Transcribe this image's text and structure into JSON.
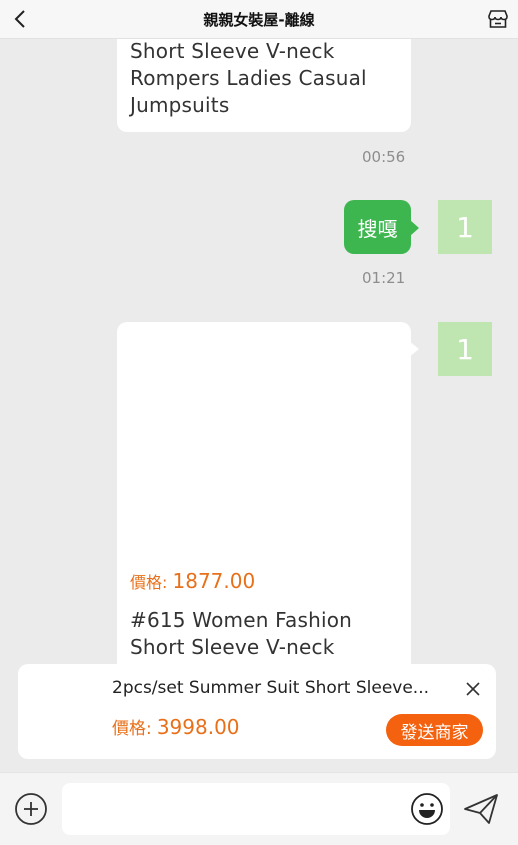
{
  "header": {
    "title": "親親女裝屋-離線",
    "back_icon": "back-arrow-icon",
    "shop_icon": "shop-icon"
  },
  "messages": {
    "first_product": {
      "text_lines": [
        "Short Sleeve V-neck",
        "Rompers Ladies Casual",
        "Jumpsuits"
      ],
      "time": "00:56"
    },
    "reply": {
      "text": "搜嘎",
      "time": "01:21"
    },
    "avatar_text": "1",
    "second_product": {
      "price_label": "價格:",
      "price": "1877.00",
      "text_lines": [
        "#615 Women Fashion",
        "Short Sleeve V-neck"
      ]
    }
  },
  "product_card": {
    "name": "2pcs/set Summer Suit Short Sleeve...",
    "price_label": "價格:",
    "price": "3998.00",
    "send_button": "發送商家"
  },
  "input_bar": {
    "placeholder": "",
    "icons": [
      "plus-circle-icon",
      "emoji-icon",
      "send-plane-icon"
    ]
  },
  "colors": {
    "accent_orange": "#f4620f",
    "price_orange": "#e8701a",
    "green": "#3db650",
    "avatar_green": "#bfe6b0"
  }
}
